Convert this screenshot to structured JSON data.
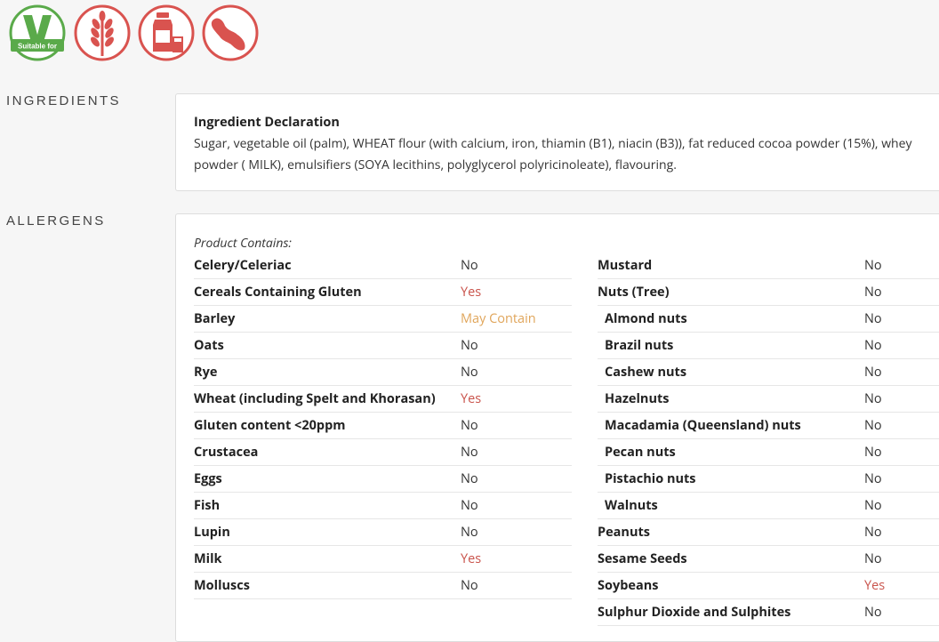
{
  "badges": {
    "vegan_label": "Suitable for",
    "items": [
      "vegan-suitable-icon",
      "wheat-icon",
      "milk-icon",
      "soya-icon"
    ],
    "colors": {
      "green": "#5aaa4a",
      "red": "#d9534f"
    }
  },
  "ingredients": {
    "section_label": "INGREDIENTS",
    "title": "Ingredient Declaration",
    "text": "Sugar, vegetable oil (palm), WHEAT flour (with calcium, iron, thiamin (B1), niacin (B3)), fat reduced cocoa powder (15%), whey powder ( MILK), emulsifiers (SOYA lecithins, polyglycerol polyricinoleate), flavouring."
  },
  "allergens": {
    "section_label": "ALLERGENS",
    "contains_label": "Product Contains:",
    "left": [
      {
        "name": "Celery/Celeriac",
        "value": "No",
        "status": "no",
        "sub": false
      },
      {
        "name": "Cereals Containing Gluten",
        "value": "Yes",
        "status": "yes",
        "sub": false
      },
      {
        "name": "Barley",
        "value": "May Contain",
        "status": "may",
        "sub": false
      },
      {
        "name": "Oats",
        "value": "No",
        "status": "no",
        "sub": false
      },
      {
        "name": "Rye",
        "value": "No",
        "status": "no",
        "sub": false
      },
      {
        "name": "Wheat (including Spelt and Khorasan)",
        "value": "Yes",
        "status": "yes",
        "sub": false
      },
      {
        "name": "Gluten content <20ppm",
        "value": "No",
        "status": "no",
        "sub": false
      },
      {
        "name": "Crustacea",
        "value": "No",
        "status": "no",
        "sub": false
      },
      {
        "name": "Eggs",
        "value": "No",
        "status": "no",
        "sub": false
      },
      {
        "name": "Fish",
        "value": "No",
        "status": "no",
        "sub": false
      },
      {
        "name": "Lupin",
        "value": "No",
        "status": "no",
        "sub": false
      },
      {
        "name": "Milk",
        "value": "Yes",
        "status": "yes",
        "sub": false
      },
      {
        "name": "Molluscs",
        "value": "No",
        "status": "no",
        "sub": false
      }
    ],
    "right": [
      {
        "name": "Mustard",
        "value": "No",
        "status": "no",
        "sub": false
      },
      {
        "name": "Nuts (Tree)",
        "value": "No",
        "status": "no",
        "sub": false
      },
      {
        "name": "Almond nuts",
        "value": "No",
        "status": "no",
        "sub": true
      },
      {
        "name": "Brazil nuts",
        "value": "No",
        "status": "no",
        "sub": true
      },
      {
        "name": "Cashew nuts",
        "value": "No",
        "status": "no",
        "sub": true
      },
      {
        "name": "Hazelnuts",
        "value": "No",
        "status": "no",
        "sub": true
      },
      {
        "name": "Macadamia (Queensland) nuts",
        "value": "No",
        "status": "no",
        "sub": true
      },
      {
        "name": "Pecan nuts",
        "value": "No",
        "status": "no",
        "sub": true
      },
      {
        "name": "Pistachio nuts",
        "value": "No",
        "status": "no",
        "sub": true
      },
      {
        "name": "Walnuts",
        "value": "No",
        "status": "no",
        "sub": true
      },
      {
        "name": "Peanuts",
        "value": "No",
        "status": "no",
        "sub": false
      },
      {
        "name": "Sesame Seeds",
        "value": "No",
        "status": "no",
        "sub": false
      },
      {
        "name": "Soybeans",
        "value": "Yes",
        "status": "yes",
        "sub": false
      },
      {
        "name": "Sulphur Dioxide and Sulphites",
        "value": "No",
        "status": "no",
        "sub": false
      }
    ]
  }
}
